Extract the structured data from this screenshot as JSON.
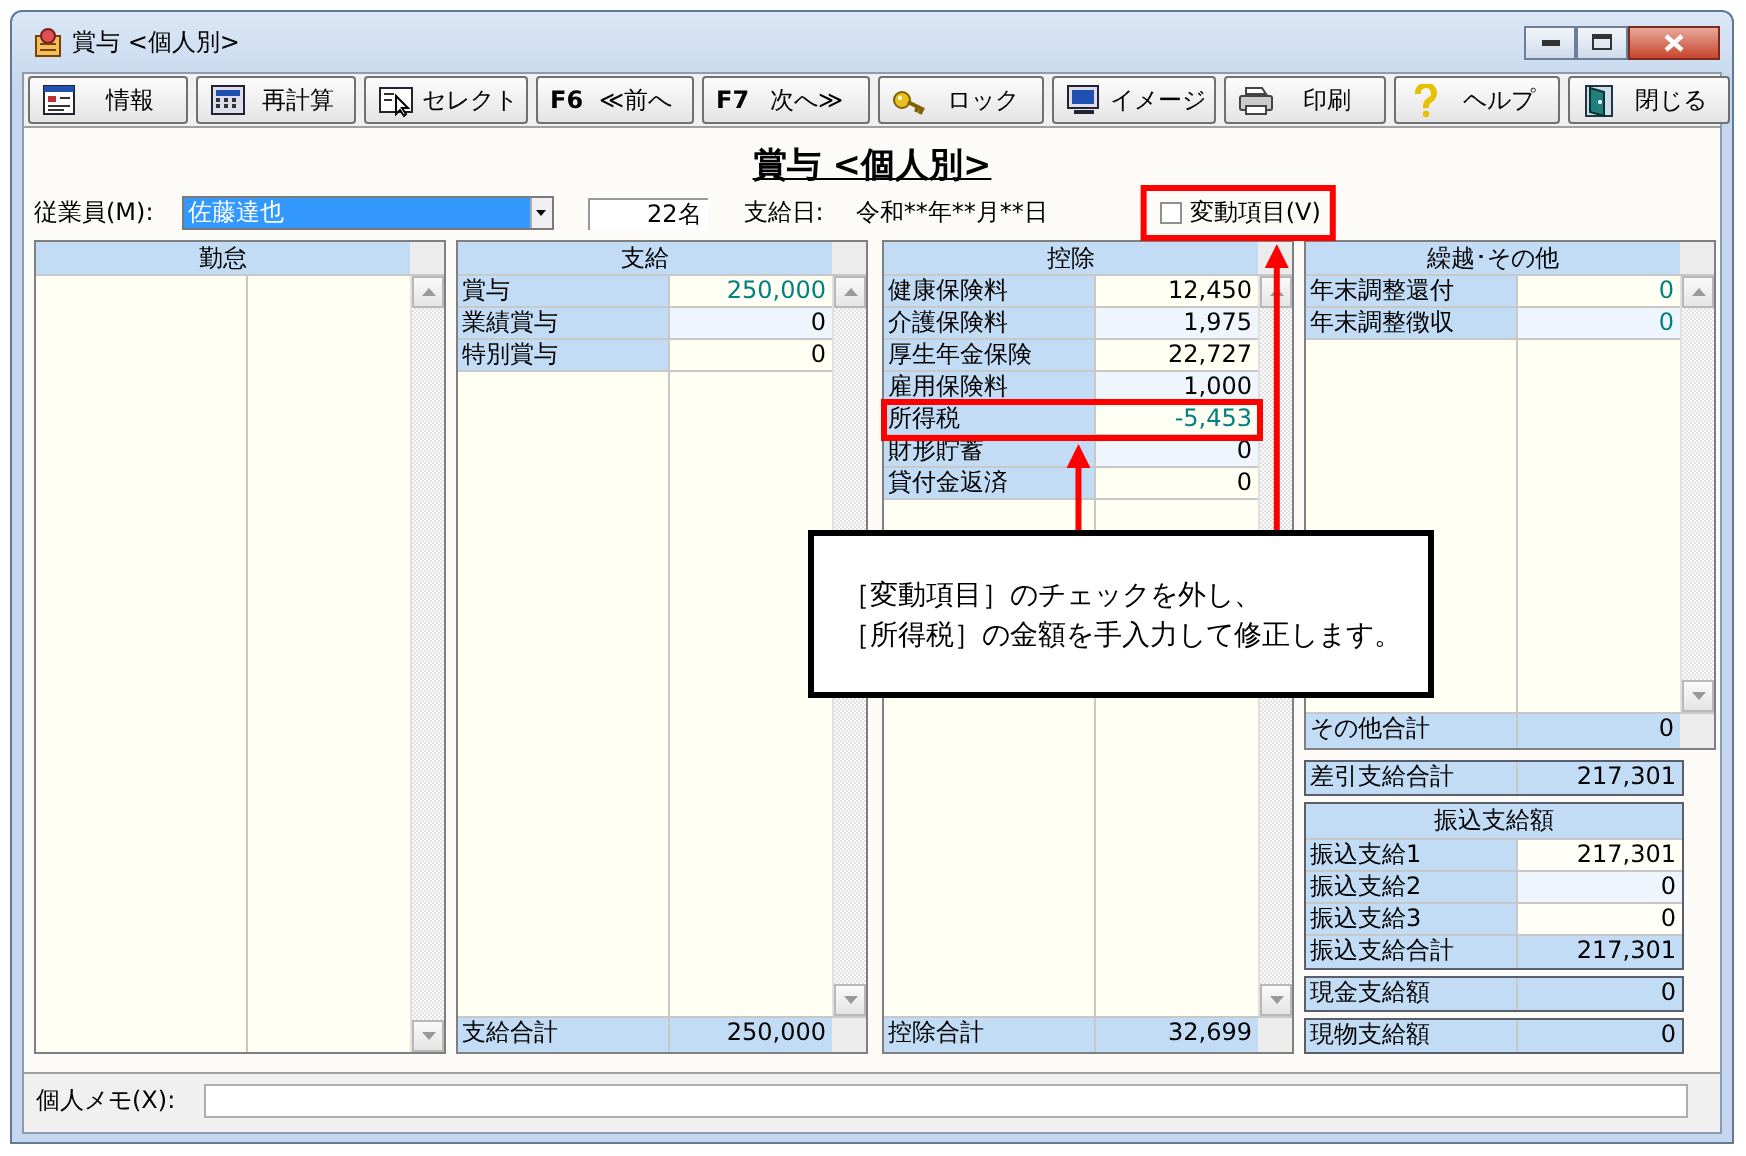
{
  "window": {
    "title": "賞与 <個人別>"
  },
  "toolbar": [
    {
      "kind": "info",
      "label": "情報"
    },
    {
      "kind": "recalc",
      "label": "再計算"
    },
    {
      "kind": "select",
      "label": "セレクト"
    },
    {
      "kind": "prev",
      "key": "F6",
      "label": "≪前へ"
    },
    {
      "kind": "next",
      "key": "F7",
      "label": "次へ≫"
    },
    {
      "kind": "lock",
      "label": "ロック"
    },
    {
      "kind": "image",
      "label": "イメージ"
    },
    {
      "kind": "print",
      "label": "印刷"
    },
    {
      "kind": "help",
      "label": "ヘルプ"
    },
    {
      "kind": "close",
      "label": "閉じる"
    }
  ],
  "heading": "賞与 <個人別>",
  "employee": {
    "label": "従業員(M):",
    "value": "佐藤達也",
    "highlighted": true,
    "count": "22名"
  },
  "pay_date": {
    "label": "支給日:",
    "value": "令和**年**月**日"
  },
  "variable_items": {
    "label": "変動項目(V)",
    "checked": false,
    "marked": true
  },
  "attendance": {
    "title": "勤怠"
  },
  "payments": {
    "title": "支給",
    "rows": [
      {
        "label": "賞与",
        "value": "250,000",
        "color": "#008080"
      },
      {
        "label": "業績賞与",
        "value": "0",
        "color": "#000000"
      },
      {
        "label": "特別賞与",
        "value": "0",
        "color": "#000000"
      }
    ],
    "total": {
      "label": "支給合計",
      "value": "250,000"
    }
  },
  "deductions": {
    "title": "控除",
    "rows": [
      {
        "label": "健康保険料",
        "value": "12,450",
        "color": "#000000",
        "marked": false
      },
      {
        "label": "介護保険料",
        "value": "1,975",
        "color": "#000000",
        "marked": false
      },
      {
        "label": "厚生年金保険",
        "value": "22,727",
        "color": "#000000",
        "marked": false
      },
      {
        "label": "雇用保険料",
        "value": "1,000",
        "color": "#000000",
        "marked": false
      },
      {
        "label": "所得税",
        "value": "-5,453",
        "color": "#008080",
        "marked": true
      },
      {
        "label": "財形貯蓄",
        "value": "0",
        "color": "#000000",
        "marked": false
      },
      {
        "label": "貸付金返済",
        "value": "0",
        "color": "#000000",
        "marked": false
      }
    ],
    "total": {
      "label": "控除合計",
      "value": "32,699"
    }
  },
  "other": {
    "title": "繰越･その他",
    "rows": [
      {
        "label": "年末調整還付",
        "value": "0",
        "color": "#008080"
      },
      {
        "label": "年末調整徴収",
        "value": "0",
        "color": "#008080"
      }
    ],
    "total": {
      "label": "その他合計",
      "value": "0"
    }
  },
  "net_total": {
    "label": "差引支給合計",
    "value": "217,301"
  },
  "transfer": {
    "title": "振込支給額",
    "rows": [
      {
        "label": "振込支給1",
        "value": "217,301"
      },
      {
        "label": "振込支給2",
        "value": "0"
      },
      {
        "label": "振込支給3",
        "value": "0"
      }
    ],
    "total": {
      "label": "振込支給合計",
      "value": "217,301"
    }
  },
  "cash": {
    "label": "現金支給額",
    "value": "0"
  },
  "in_kind": {
    "label": "現物支給額",
    "value": "0"
  },
  "memo": {
    "label": "個人メモ(X):"
  },
  "callout": {
    "lines": [
      "［変動項目］のチェックを外し、",
      "［所得税］の金額を手入力して修正します。"
    ]
  }
}
